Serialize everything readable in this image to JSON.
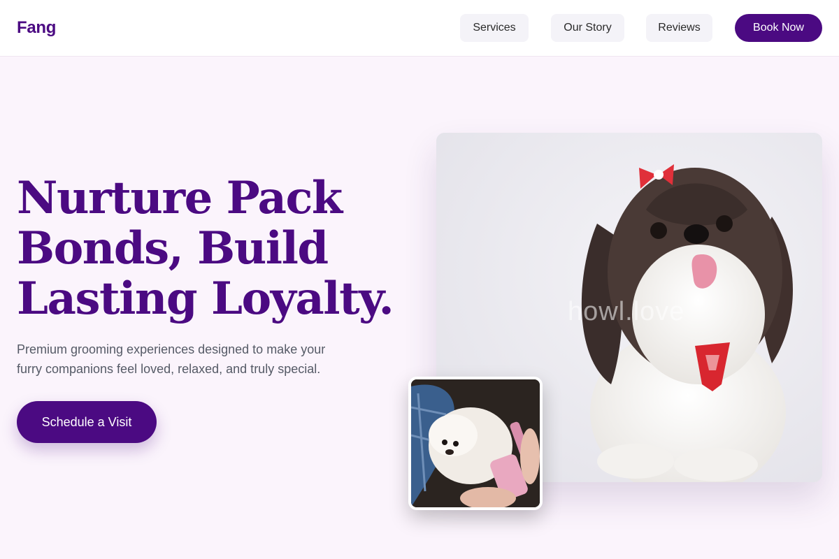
{
  "nav": {
    "brand": "Fang",
    "links": [
      "Services",
      "Our Story",
      "Reviews"
    ],
    "cta": "Book Now"
  },
  "hero": {
    "headline_lines": [
      "Nurture Pack",
      "Bonds, Build",
      "Lasting Loyalty."
    ],
    "subtitle_lines": [
      "Premium grooming experiences designed to make your",
      "furry companions feel loved, relaxed, and truly special."
    ],
    "cta": "Schedule a Visit",
    "main_image": {
      "subject": "shih-tzu-dog-photo",
      "watermark": "howl.love"
    },
    "thumb_image": {
      "subject": "grooming-small-white-dog-photo"
    }
  },
  "colors": {
    "brand": "#4b0a82",
    "page_bg": "#fbf4fc",
    "nav_link_bg": "#f4f3f8",
    "subtitle_text": "#555a66"
  }
}
